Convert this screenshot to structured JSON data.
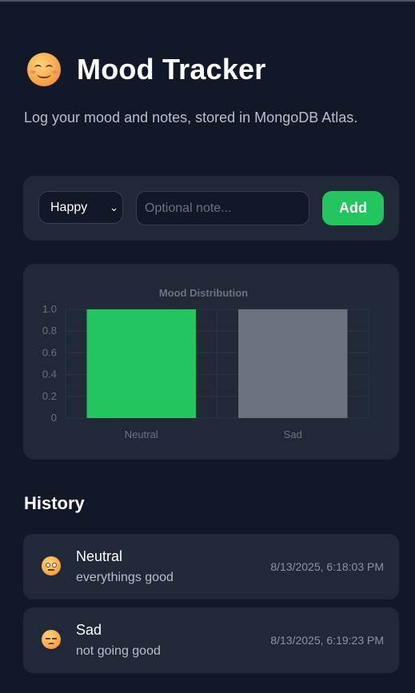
{
  "app": {
    "title": "Mood Tracker",
    "title_icon": "smiling-face-icon",
    "subtitle": "Log your mood and notes, stored in MongoDB Atlas."
  },
  "form": {
    "mood_selected": "Happy",
    "mood_options": [
      "Happy"
    ],
    "note_value": "",
    "note_placeholder": "Optional note...",
    "add_label": "Add"
  },
  "chart_data": {
    "type": "bar",
    "title": "Mood Distribution",
    "categories": [
      "Neutral",
      "Sad"
    ],
    "values": [
      1,
      1
    ],
    "colors": [
      "#22c55e",
      "#6b7280"
    ],
    "ylim": [
      0,
      1
    ],
    "yticks": [
      "0",
      "0.2",
      "0.4",
      "0.6",
      "0.8",
      "1.0"
    ],
    "xlabel": "",
    "ylabel": "",
    "grid": true
  },
  "history": {
    "title": "History",
    "items": [
      {
        "mood": "Neutral",
        "note": "everythings good",
        "time": "8/13/2025, 6:18:03 PM",
        "icon": "neutral-face-icon"
      },
      {
        "mood": "Sad",
        "note": "not going good",
        "time": "8/13/2025, 6:19:23 PM",
        "icon": "pensive-face-icon"
      }
    ]
  },
  "colors": {
    "background": "#111827",
    "card": "#1f2937",
    "accent": "#22c55e"
  }
}
